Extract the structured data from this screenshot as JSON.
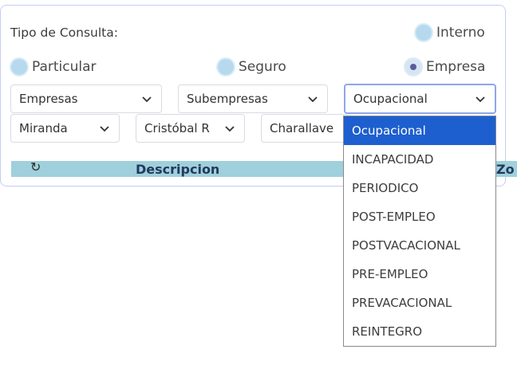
{
  "form": {
    "title": "Tipo de Consulta:",
    "radios": {
      "interno": "Interno",
      "particular": "Particular",
      "seguro": "Seguro",
      "empresa": "Empresa",
      "selected": "Empresa"
    },
    "selects": {
      "empresas": "Empresas",
      "subempresas": "Subempresas",
      "tipo": "Ocupacional",
      "estado": "Miranda",
      "municipio": "Cristóbal R",
      "parroquia": "Charallave"
    }
  },
  "table": {
    "refresh_icon": "refresh-icon",
    "col_descripcion": "Descripcion",
    "col_zona_partial": "Zo"
  },
  "dropdown": {
    "selected_index": 0,
    "options": [
      "Ocupacional",
      "INCAPACIDAD",
      "PERIODICO",
      "POST-EMPLEO",
      "POSTVACACIONAL",
      "PRE-EMPLEO",
      "PREVACACIONAL",
      "REINTEGRO"
    ]
  },
  "colors": {
    "accent": "#1d5fcf",
    "table_header": "#9fd0dc",
    "panel_border": "#c5cdf3"
  }
}
